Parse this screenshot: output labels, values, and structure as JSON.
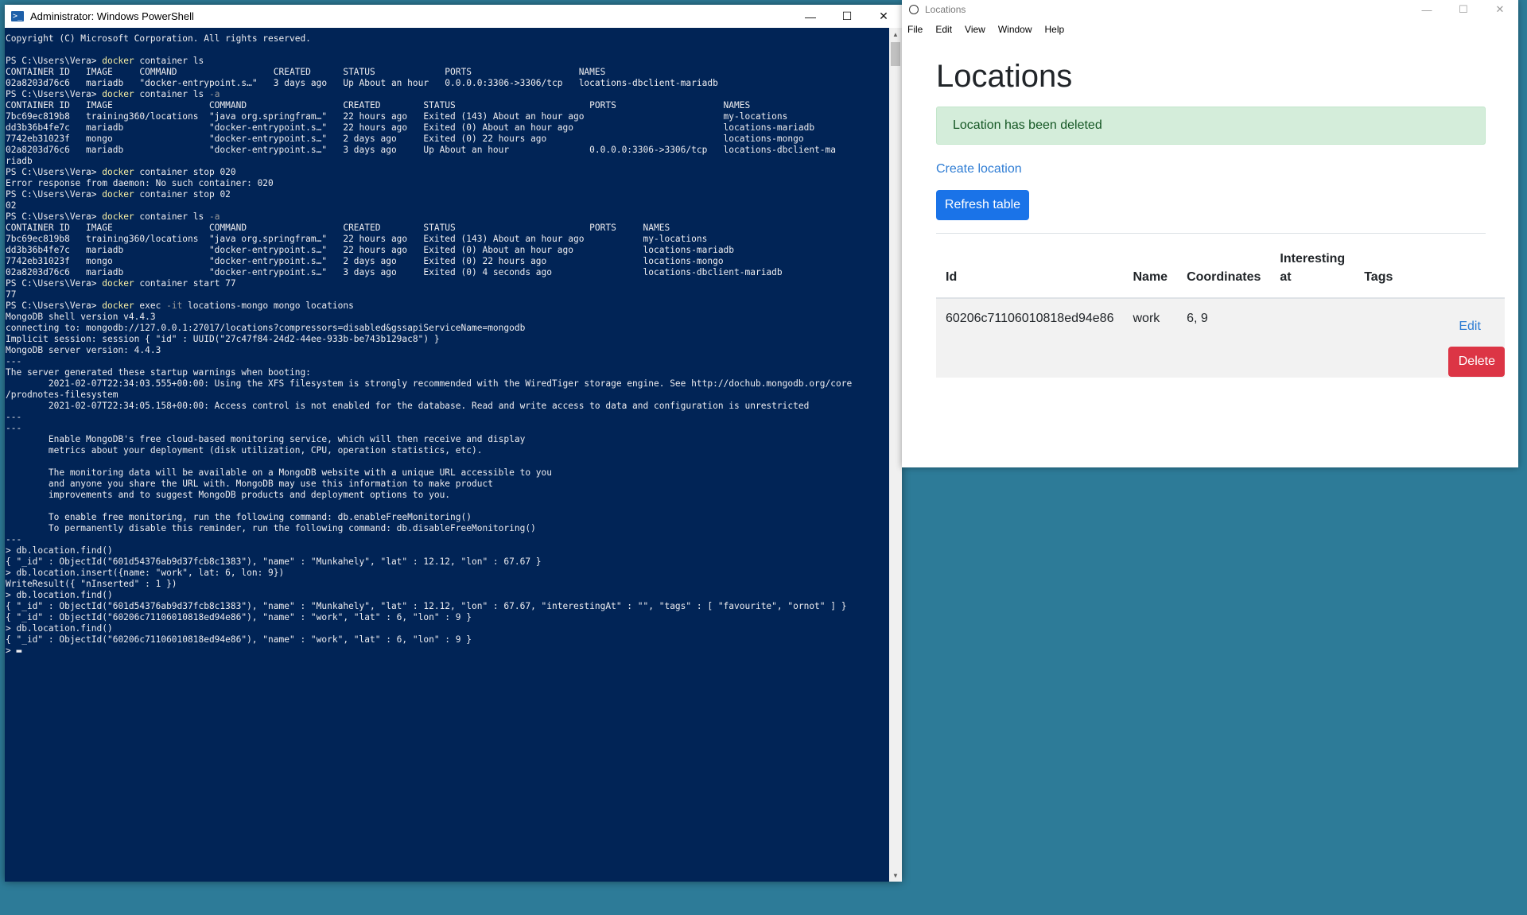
{
  "powershell": {
    "title": "Administrator: Windows PowerShell",
    "controls": {
      "minimize": "—",
      "maximize": "☐",
      "close": "✕"
    },
    "lines": [
      {
        "t": "Copyright (C) Microsoft Corporation. All rights reserved."
      },
      {
        "t": ""
      },
      {
        "p": "PS C:\\Users\\Vera> ",
        "c": "docker",
        "t": " container ls"
      },
      {
        "t": "CONTAINER ID   IMAGE     COMMAND                  CREATED      STATUS             PORTS                    NAMES"
      },
      {
        "t": "02a8203d76c6   mariadb   \"docker-entrypoint.s…\"   3 days ago   Up About an hour   0.0.0.0:3306->3306/tcp   locations-dbclient-mariadb"
      },
      {
        "p": "PS C:\\Users\\Vera> ",
        "c": "docker",
        "t": " container ls ",
        "f": "-a"
      },
      {
        "t": "CONTAINER ID   IMAGE                  COMMAND                  CREATED        STATUS                         PORTS                    NAMES"
      },
      {
        "t": "7bc69ec819b8   training360/locations  \"java org.springfram…\"   22 hours ago   Exited (143) About an hour ago                          my-locations"
      },
      {
        "t": "dd3b36b4fe7c   mariadb                \"docker-entrypoint.s…\"   22 hours ago   Exited (0) About an hour ago                            locations-mariadb"
      },
      {
        "t": "7742eb31023f   mongo                  \"docker-entrypoint.s…\"   2 days ago     Exited (0) 22 hours ago                                 locations-mongo"
      },
      {
        "t": "02a8203d76c6   mariadb                \"docker-entrypoint.s…\"   3 days ago     Up About an hour               0.0.0.0:3306->3306/tcp   locations-dbclient-ma"
      },
      {
        "t": "riadb"
      },
      {
        "p": "PS C:\\Users\\Vera> ",
        "c": "docker",
        "t": " container stop 020"
      },
      {
        "t": "Error response from daemon: No such container: 020"
      },
      {
        "p": "PS C:\\Users\\Vera> ",
        "c": "docker",
        "t": " container stop 02"
      },
      {
        "t": "02"
      },
      {
        "p": "PS C:\\Users\\Vera> ",
        "c": "docker",
        "t": " container ls ",
        "f": "-a"
      },
      {
        "t": "CONTAINER ID   IMAGE                  COMMAND                  CREATED        STATUS                         PORTS     NAMES"
      },
      {
        "t": "7bc69ec819b8   training360/locations  \"java org.springfram…\"   22 hours ago   Exited (143) About an hour ago           my-locations"
      },
      {
        "t": "dd3b36b4fe7c   mariadb                \"docker-entrypoint.s…\"   22 hours ago   Exited (0) About an hour ago             locations-mariadb"
      },
      {
        "t": "7742eb31023f   mongo                  \"docker-entrypoint.s…\"   2 days ago     Exited (0) 22 hours ago                  locations-mongo"
      },
      {
        "t": "02a8203d76c6   mariadb                \"docker-entrypoint.s…\"   3 days ago     Exited (0) 4 seconds ago                 locations-dbclient-mariadb"
      },
      {
        "p": "PS C:\\Users\\Vera> ",
        "c": "docker",
        "t": " container start 77"
      },
      {
        "t": "77"
      },
      {
        "p": "PS C:\\Users\\Vera> ",
        "c": "docker",
        "t": " exec ",
        "f": "-it",
        "t2": " locations-mongo mongo locations"
      },
      {
        "t": "MongoDB shell version v4.4.3"
      },
      {
        "t": "connecting to: mongodb://127.0.0.1:27017/locations?compressors=disabled&gssapiServiceName=mongodb"
      },
      {
        "t": "Implicit session: session { \"id\" : UUID(\"27c47f84-24d2-44ee-933b-be743b129ac8\") }"
      },
      {
        "t": "MongoDB server version: 4.4.3"
      },
      {
        "t": "---"
      },
      {
        "t": "The server generated these startup warnings when booting:"
      },
      {
        "t": "        2021-02-07T22:34:03.555+00:00: Using the XFS filesystem is strongly recommended with the WiredTiger storage engine. See http://dochub.mongodb.org/core"
      },
      {
        "t": "/prodnotes-filesystem"
      },
      {
        "t": "        2021-02-07T22:34:05.158+00:00: Access control is not enabled for the database. Read and write access to data and configuration is unrestricted"
      },
      {
        "t": "---"
      },
      {
        "t": "---"
      },
      {
        "t": "        Enable MongoDB's free cloud-based monitoring service, which will then receive and display"
      },
      {
        "t": "        metrics about your deployment (disk utilization, CPU, operation statistics, etc)."
      },
      {
        "t": ""
      },
      {
        "t": "        The monitoring data will be available on a MongoDB website with a unique URL accessible to you"
      },
      {
        "t": "        and anyone you share the URL with. MongoDB may use this information to make product"
      },
      {
        "t": "        improvements and to suggest MongoDB products and deployment options to you."
      },
      {
        "t": ""
      },
      {
        "t": "        To enable free monitoring, run the following command: db.enableFreeMonitoring()"
      },
      {
        "t": "        To permanently disable this reminder, run the following command: db.disableFreeMonitoring()"
      },
      {
        "t": "---"
      },
      {
        "t": "> db.location.find()"
      },
      {
        "t": "{ \"_id\" : ObjectId(\"601d54376ab9d37fcb8c1383\"), \"name\" : \"Munkahely\", \"lat\" : 12.12, \"lon\" : 67.67 }"
      },
      {
        "t": "> db.location.insert({name: \"work\", lat: 6, lon: 9})"
      },
      {
        "t": "WriteResult({ \"nInserted\" : 1 })"
      },
      {
        "t": "> db.location.find()"
      },
      {
        "t": "{ \"_id\" : ObjectId(\"601d54376ab9d37fcb8c1383\"), \"name\" : \"Munkahely\", \"lat\" : 12.12, \"lon\" : 67.67, \"interestingAt\" : \"\", \"tags\" : [ \"favourite\", \"ornot\" ] }"
      },
      {
        "t": "{ \"_id\" : ObjectId(\"60206c71106010818ed94e86\"), \"name\" : \"work\", \"lat\" : 6, \"lon\" : 9 }"
      },
      {
        "t": "> db.location.find()"
      },
      {
        "t": "{ \"_id\" : ObjectId(\"60206c71106010818ed94e86\"), \"name\" : \"work\", \"lat\" : 6, \"lon\" : 9 }"
      },
      {
        "t": "> ",
        "cursor": "▬"
      }
    ],
    "colors": {
      "background": "#012456",
      "text": "#eeedf0",
      "command": "#f9f1a5",
      "flag": "#9a9a9a"
    }
  },
  "locations_app": {
    "title": "Locations",
    "controls": {
      "minimize": "—",
      "maximize": "☐",
      "close": "✕"
    },
    "menu": [
      "File",
      "Edit",
      "View",
      "Window",
      "Help"
    ],
    "page_title": "Locations",
    "alert_text": "Location has been deleted",
    "create_link": "Create location",
    "refresh_button": "Refresh table",
    "table": {
      "headers": [
        "Id",
        "Name",
        "Coordinates",
        "Interesting at",
        "Tags"
      ],
      "rows": [
        {
          "id": "60206c71106010818ed94e86",
          "name": "work",
          "coordinates": "6, 9",
          "interesting_at": "",
          "tags": "",
          "edit_label": "Edit",
          "delete_label": "Delete"
        }
      ]
    },
    "colors": {
      "primary": "#1a73e8",
      "danger": "#dc3545",
      "success_bg": "#d4edda",
      "link": "#2f7dd4"
    }
  },
  "desktop": {
    "background": "#2d7b98"
  }
}
